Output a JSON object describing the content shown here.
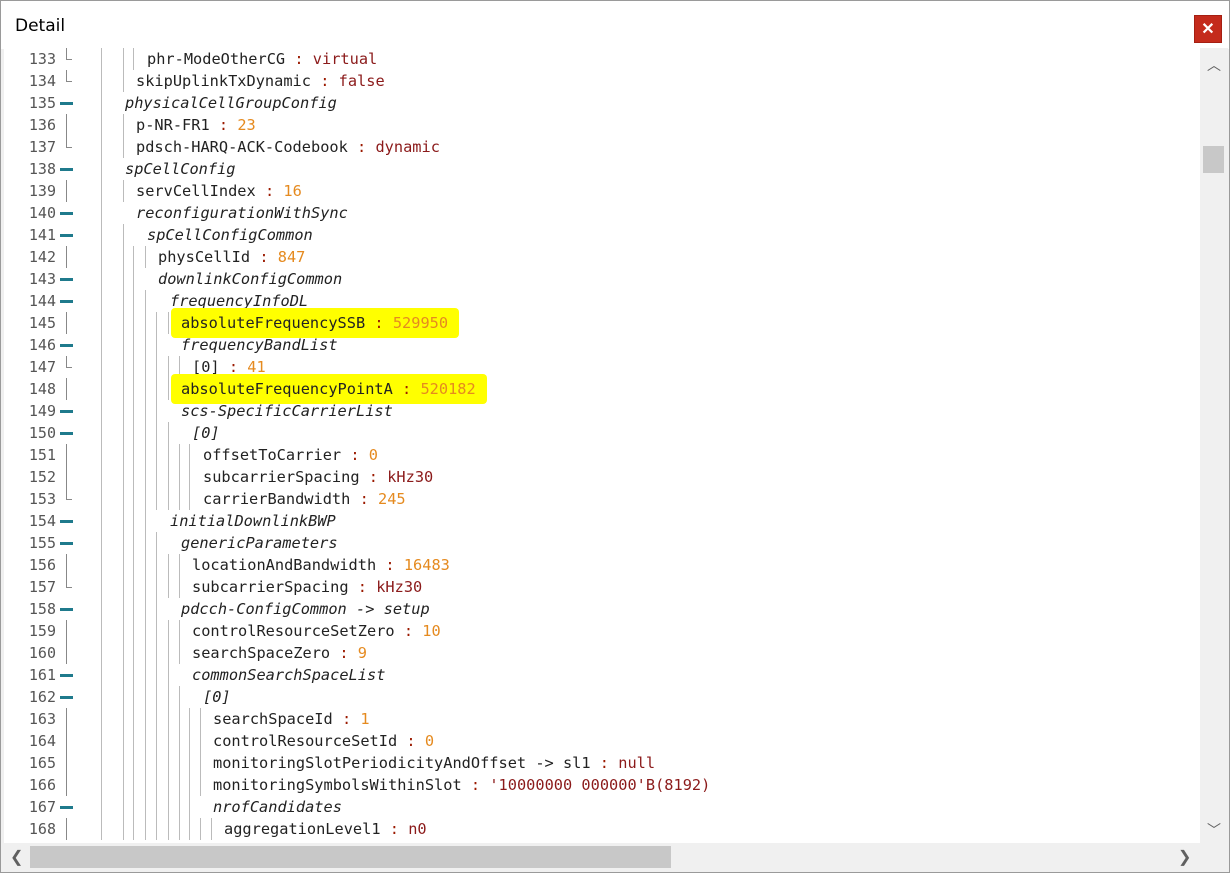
{
  "window": {
    "title": "Detail",
    "close_label": "✕"
  },
  "colors": {
    "highlight": "#ffff00",
    "string_value": "#8b1a1a",
    "number_value": "#e58a1f",
    "fold_minus": "#1f7a8c"
  },
  "lines": [
    {
      "num": "133",
      "fold": "end",
      "key": "phr-ModeOtherCG",
      "kind": "field",
      "value": "virtual",
      "vtype": "str",
      "indent": 3
    },
    {
      "num": "134",
      "fold": "end",
      "key": "skipUplinkTxDynamic",
      "kind": "field",
      "value": "false",
      "vtype": "str",
      "indent": 2
    },
    {
      "num": "135",
      "fold": "open",
      "key": "physicalCellGroupConfig",
      "kind": "section",
      "value": "",
      "vtype": "",
      "indent": 1
    },
    {
      "num": "136",
      "fold": "mid",
      "key": "p-NR-FR1",
      "kind": "field",
      "value": "23",
      "vtype": "num",
      "indent": 2
    },
    {
      "num": "137",
      "fold": "end",
      "key": "pdsch-HARQ-ACK-Codebook",
      "kind": "field",
      "value": "dynamic",
      "vtype": "str",
      "indent": 2
    },
    {
      "num": "138",
      "fold": "open",
      "key": "spCellConfig",
      "kind": "section",
      "value": "",
      "vtype": "",
      "indent": 1
    },
    {
      "num": "139",
      "fold": "mid",
      "key": "servCellIndex",
      "kind": "field",
      "value": "16",
      "vtype": "num",
      "indent": 2
    },
    {
      "num": "140",
      "fold": "open",
      "key": "reconfigurationWithSync",
      "kind": "section",
      "value": "",
      "vtype": "",
      "indent": 2
    },
    {
      "num": "141",
      "fold": "open",
      "key": "spCellConfigCommon",
      "kind": "section",
      "value": "",
      "vtype": "",
      "indent": 3
    },
    {
      "num": "142",
      "fold": "mid",
      "key": "physCellId",
      "kind": "field",
      "value": "847",
      "vtype": "num",
      "indent": 4
    },
    {
      "num": "143",
      "fold": "open",
      "key": "downlinkConfigCommon",
      "kind": "section",
      "value": "",
      "vtype": "",
      "indent": 4
    },
    {
      "num": "144",
      "fold": "open",
      "key": "frequencyInfoDL",
      "kind": "section",
      "value": "",
      "vtype": "",
      "indent": 5
    },
    {
      "num": "145",
      "fold": "mid",
      "key": "absoluteFrequencySSB",
      "kind": "field",
      "value": "529950",
      "vtype": "num",
      "indent": 6,
      "highlight": true
    },
    {
      "num": "146",
      "fold": "open",
      "key": "frequencyBandList",
      "kind": "section",
      "value": "",
      "vtype": "",
      "indent": 6
    },
    {
      "num": "147",
      "fold": "end",
      "key": "[0]",
      "kind": "field",
      "value": "41",
      "vtype": "num",
      "indent": 7
    },
    {
      "num": "148",
      "fold": "mid",
      "key": "absoluteFrequencyPointA",
      "kind": "field",
      "value": "520182",
      "vtype": "num",
      "indent": 6,
      "highlight": true
    },
    {
      "num": "149",
      "fold": "open",
      "key": "scs-SpecificCarrierList",
      "kind": "section",
      "value": "",
      "vtype": "",
      "indent": 6
    },
    {
      "num": "150",
      "fold": "open",
      "key": "[0]",
      "kind": "section",
      "value": "",
      "vtype": "",
      "indent": 7
    },
    {
      "num": "151",
      "fold": "mid",
      "key": "offsetToCarrier",
      "kind": "field",
      "value": "0",
      "vtype": "num",
      "indent": 8
    },
    {
      "num": "152",
      "fold": "mid",
      "key": "subcarrierSpacing",
      "kind": "field",
      "value": "kHz30",
      "vtype": "str",
      "indent": 8
    },
    {
      "num": "153",
      "fold": "end",
      "key": "carrierBandwidth",
      "kind": "field",
      "value": "245",
      "vtype": "num",
      "indent": 8
    },
    {
      "num": "154",
      "fold": "open",
      "key": "initialDownlinkBWP",
      "kind": "section",
      "value": "",
      "vtype": "",
      "indent": 5
    },
    {
      "num": "155",
      "fold": "open",
      "key": "genericParameters",
      "kind": "section",
      "value": "",
      "vtype": "",
      "indent": 6
    },
    {
      "num": "156",
      "fold": "mid",
      "key": "locationAndBandwidth",
      "kind": "field",
      "value": "16483",
      "vtype": "num",
      "indent": 7
    },
    {
      "num": "157",
      "fold": "end",
      "key": "subcarrierSpacing",
      "kind": "field",
      "value": "kHz30",
      "vtype": "str",
      "indent": 7
    },
    {
      "num": "158",
      "fold": "open",
      "key": "pdcch-ConfigCommon -> setup",
      "kind": "section",
      "value": "",
      "vtype": "",
      "indent": 6
    },
    {
      "num": "159",
      "fold": "mid",
      "key": "controlResourceSetZero",
      "kind": "field",
      "value": "10",
      "vtype": "num",
      "indent": 7
    },
    {
      "num": "160",
      "fold": "mid",
      "key": "searchSpaceZero",
      "kind": "field",
      "value": "9",
      "vtype": "num",
      "indent": 7
    },
    {
      "num": "161",
      "fold": "open",
      "key": "commonSearchSpaceList",
      "kind": "section",
      "value": "",
      "vtype": "",
      "indent": 7
    },
    {
      "num": "162",
      "fold": "open",
      "key": "[0]",
      "kind": "section",
      "value": "",
      "vtype": "",
      "indent": 8
    },
    {
      "num": "163",
      "fold": "mid",
      "key": "searchSpaceId",
      "kind": "field",
      "value": "1",
      "vtype": "num",
      "indent": 9
    },
    {
      "num": "164",
      "fold": "mid",
      "key": "controlResourceSetId",
      "kind": "field",
      "value": "0",
      "vtype": "num",
      "indent": 9
    },
    {
      "num": "165",
      "fold": "mid",
      "key": "monitoringSlotPeriodicityAndOffset -> sl1",
      "kind": "field",
      "value": "null",
      "vtype": "str",
      "indent": 9
    },
    {
      "num": "166",
      "fold": "mid",
      "key": "monitoringSymbolsWithinSlot",
      "kind": "field",
      "value": "'10000000 000000'B(8192)",
      "vtype": "str",
      "indent": 9
    },
    {
      "num": "167",
      "fold": "open",
      "key": "nrofCandidates",
      "kind": "section",
      "value": "",
      "vtype": "",
      "indent": 9
    },
    {
      "num": "168",
      "fold": "mid",
      "key": "aggregationLevel1",
      "kind": "field",
      "value": "n0",
      "vtype": "str",
      "indent": 10
    }
  ],
  "separator": " : ",
  "scroll": {
    "vertical_position": 0.13,
    "horizontal_visible": 0.54,
    "up_arrow": "︿",
    "down_arrow": "﹀",
    "left_arrow": "❮",
    "right_arrow": "❯"
  }
}
